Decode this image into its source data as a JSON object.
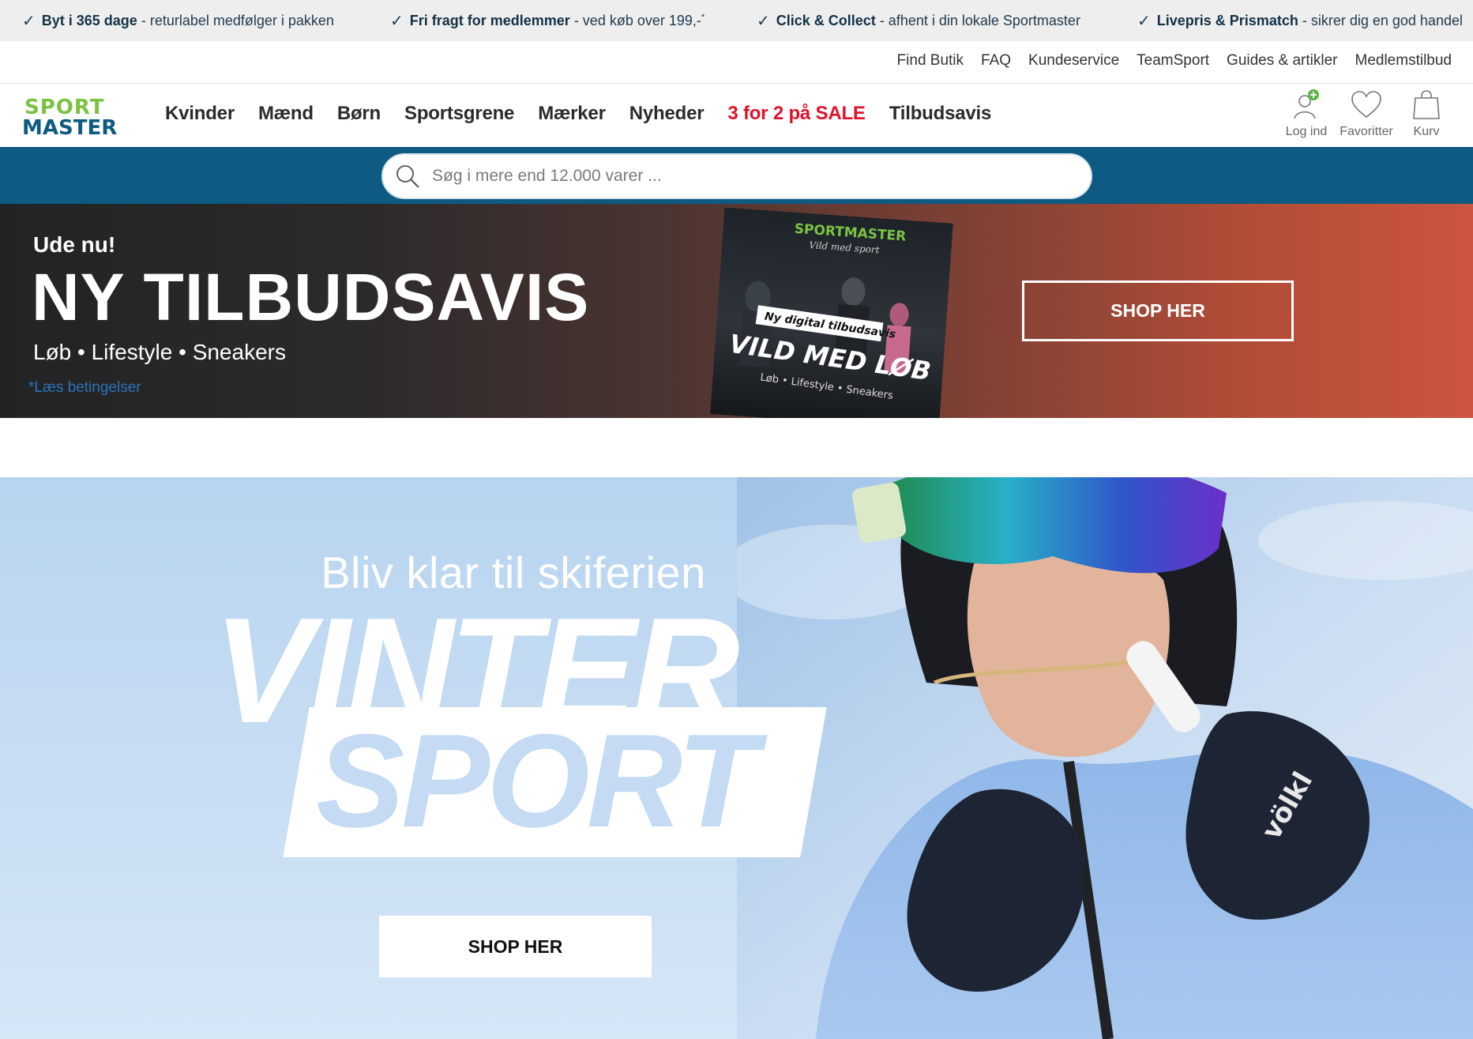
{
  "usp_bar": {
    "items": [
      {
        "bold": "Byt i 365 dage",
        "rest": " - returlabel medfølger i pakken"
      },
      {
        "bold": "Fri fragt for medlemmer",
        "rest": " - ved køb over 199,-",
        "sup": "*"
      },
      {
        "bold": "Click & Collect",
        "rest": " - afhent i din lokale Sportmaster"
      },
      {
        "bold": "Livepris & Prismatch",
        "rest": " - sikrer dig en god handel"
      }
    ],
    "check_glyph": "✓"
  },
  "service_nav": [
    "Find Butik",
    "FAQ",
    "Kundeservice",
    "TeamSport",
    "Guides & artikler",
    "Medlemstilbud"
  ],
  "logo": {
    "line1": "SPORT",
    "line2": "MASTER",
    "color_top": "#7cc242",
    "color_bottom": "#0d5a82"
  },
  "main_nav": {
    "items": [
      {
        "label": "Kvinder"
      },
      {
        "label": "Mænd"
      },
      {
        "label": "Børn"
      },
      {
        "label": "Sportsgrene"
      },
      {
        "label": "Mærker"
      },
      {
        "label": "Nyheder"
      },
      {
        "label": "3 for 2 på SALE",
        "highlight": true
      },
      {
        "label": "Tilbudsavis"
      }
    ]
  },
  "header_icons": {
    "login": {
      "label": "Log ind",
      "icon": "user-plus-icon"
    },
    "favorites": {
      "label": "Favoritter",
      "icon": "heart-icon"
    },
    "cart": {
      "label": "Kurv",
      "icon": "shopping-bag-icon"
    }
  },
  "search": {
    "placeholder": "Søg i mere end 12.000 varer ...",
    "icon": "search-icon"
  },
  "promo_banner": {
    "eyebrow": "Ude nu!",
    "title": "NY TILBUDSAVIS",
    "subtitle": "Løb • Lifestyle • Sneakers",
    "terms_link": "*Læs betingelser",
    "cta": "SHOP HER",
    "magazine": {
      "brand": "SPORTMASTER",
      "tagline": "Vild med sport",
      "ribbon": "Ny digital tilbudsavis",
      "headline": "VILD MED LØB",
      "footer": "Løb • Lifestyle • Sneakers"
    }
  },
  "hero": {
    "kicker": "Bliv klar til skiferien",
    "headline_1": "VINTER",
    "headline_2": "SPORT",
    "cta": "SHOP HER",
    "glove_brand": "völkl"
  },
  "colors": {
    "usp_bg": "#eeeeee",
    "brand_blue": "#0d5a82",
    "brand_green": "#7cc242",
    "sale_red": "#e2112a",
    "hero_blue": "#c4dbf3"
  }
}
